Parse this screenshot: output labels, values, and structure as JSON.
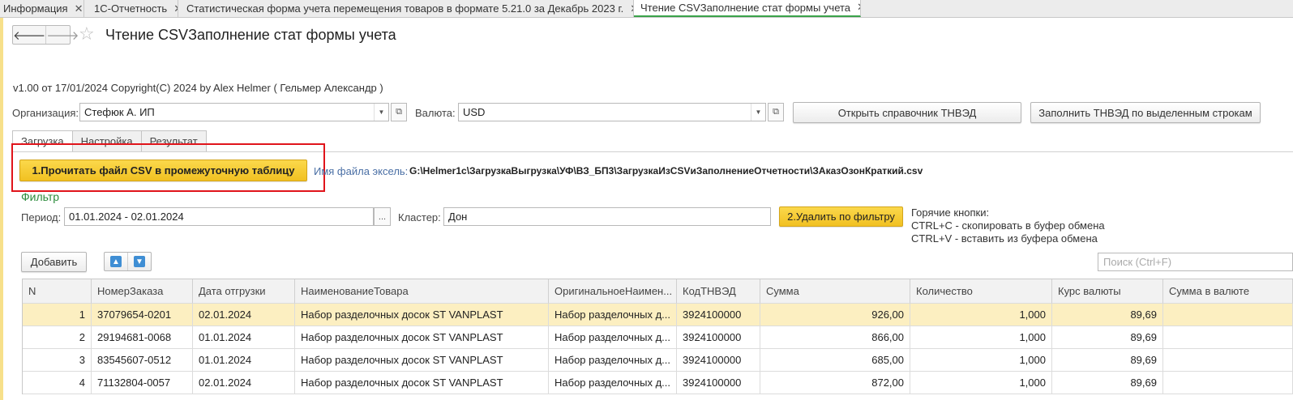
{
  "tabs": [
    {
      "label": "Информация",
      "close": "✕"
    },
    {
      "label": "1С-Отчетность",
      "close": "✕"
    },
    {
      "label": "Статистическая форма учета перемещения товаров в формате 5.21.0 за Декабрь 2023 г.",
      "close": "✕"
    },
    {
      "label": "Чтение CSVЗаполнение стат формы учета",
      "close": "✕"
    }
  ],
  "header": {
    "back": "🡐",
    "forward": "🡒",
    "star": "☆",
    "title": "Чтение CSVЗаполнение стат формы учета"
  },
  "version": "v1.00 от 17/01/2024  Copyright(C) 2024 by Alex Helmer ( Гельмер Александр )",
  "org": {
    "label": "Организация:",
    "value": "Стефюк А. ИП"
  },
  "currency": {
    "label": "Валюта:",
    "value": "USD"
  },
  "buttons": {
    "open_tnved": "Открыть справочник ТНВЭД",
    "fill_tnved": "Заполнить ТНВЭД по выделенным строкам",
    "read_csv": "1.Прочитать файл CSV в промежуточную таблицу",
    "delete_filter": "2.Удалить по фильтру",
    "add": "Добавить"
  },
  "form_tabs": [
    "Загрузка",
    "Настройка",
    "Результат"
  ],
  "file": {
    "label": "Имя файла эксель:",
    "path": "G:\\Helmer1c\\ЗагрузкаВыгрузка\\УФ\\ВЗ_БП3\\ЗагрузкаИзCSVиЗаполнениеОтчетности\\ЗАказОзонКраткий.csv"
  },
  "filter": {
    "title": "Фильтр",
    "period_label": "Период:",
    "period_value": "01.01.2024 - 02.01.2024",
    "period_btn": "...",
    "cluster_label": "Кластер:",
    "cluster_value": "Дон"
  },
  "hotkeys": [
    "Горячие кнопки:",
    "CTRL+C - скопировать в буфер обмена",
    "CTRL+V - вставить из буфера обмена"
  ],
  "search_placeholder": "Поиск (Ctrl+F)",
  "table": {
    "columns": [
      "N",
      "НомерЗаказа",
      "Дата отгрузки",
      "НаименованиеТовара",
      "ОригинальноеНаимен...",
      "КодТНВЭД",
      "Сумма",
      "Количество",
      "Курс валюты",
      "Сумма в валюте"
    ],
    "rows": [
      [
        "1",
        "37079654-0201",
        "02.01.2024",
        "Набор разделочных досок ST VANPLAST",
        "Набор разделочных д...",
        "3924100000",
        "926,00",
        "1,000",
        "89,69",
        ""
      ],
      [
        "2",
        "29194681-0068",
        "01.01.2024",
        "Набор разделочных досок ST VANPLAST",
        "Набор разделочных д...",
        "3924100000",
        "866,00",
        "1,000",
        "89,69",
        ""
      ],
      [
        "3",
        "83545607-0512",
        "01.01.2024",
        "Набор разделочных досок ST VANPLAST",
        "Набор разделочных д...",
        "3924100000",
        "685,00",
        "1,000",
        "89,69",
        ""
      ],
      [
        "4",
        "71132804-0057",
        "02.01.2024",
        "Набор разделочных досок ST VANPLAST",
        "Набор разделочных д...",
        "3924100000",
        "872,00",
        "1,000",
        "89,69",
        ""
      ]
    ]
  }
}
